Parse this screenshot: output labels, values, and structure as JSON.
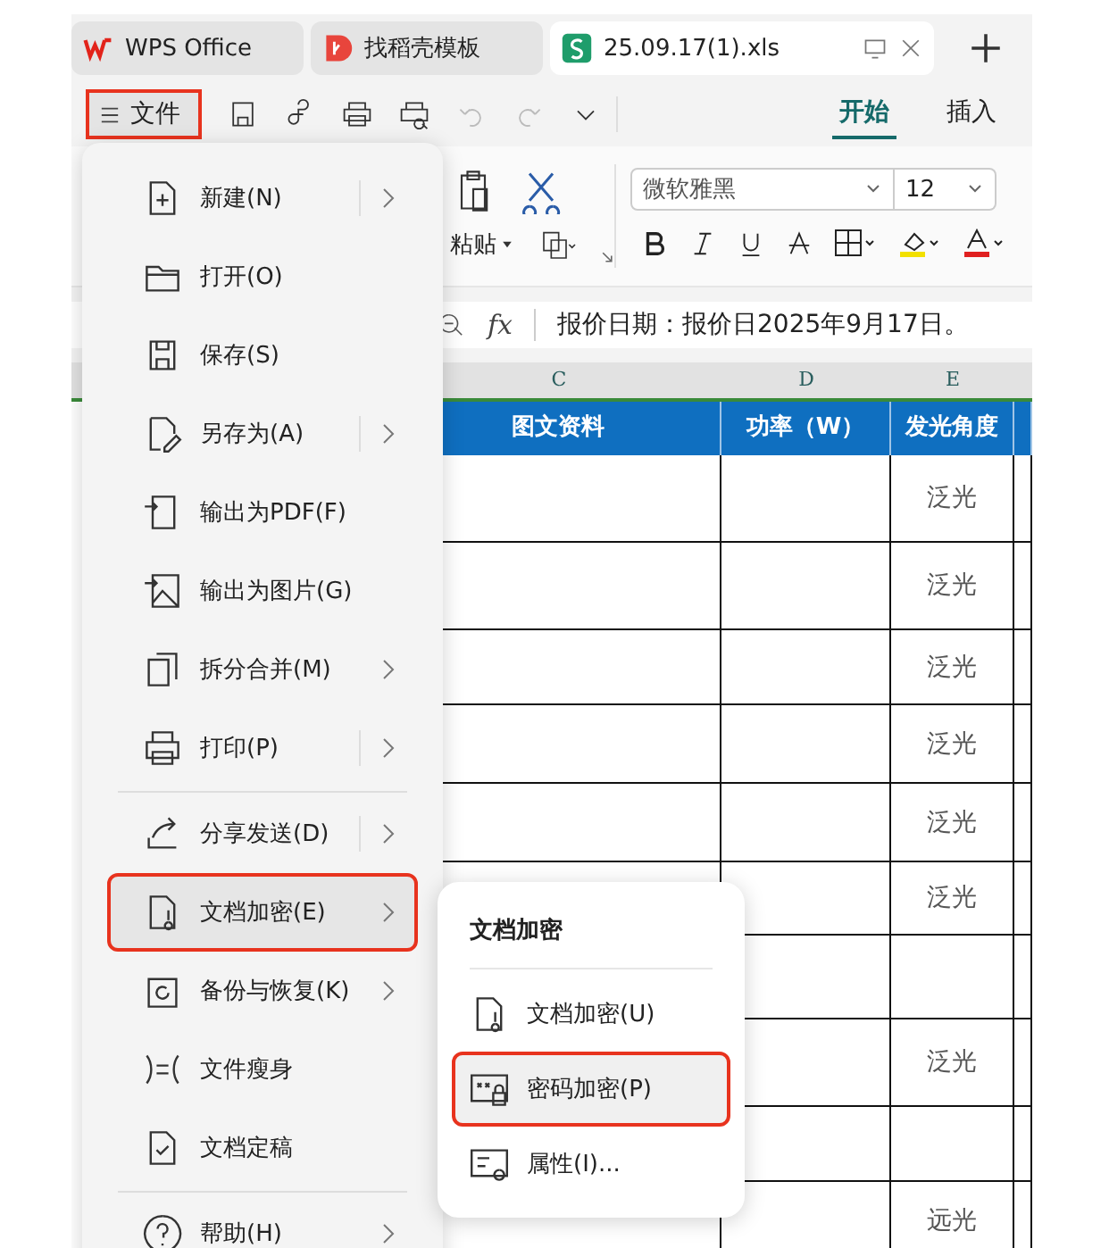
{
  "tabs": [
    {
      "label": "WPS Office",
      "kind": "wps",
      "selected": false
    },
    {
      "label": "找稻壳模板",
      "kind": "docer",
      "selected": false
    },
    {
      "label": "25.09.17(1).xls",
      "kind": "sheet",
      "selected": true
    }
  ],
  "toolbar": {
    "file_button": {
      "label": "文件",
      "annotated": true
    },
    "ribbon_tabs": [
      {
        "label": "开始",
        "selected": true
      },
      {
        "label": "插入",
        "selected": false
      }
    ]
  },
  "ribbon": {
    "paste_label": "粘贴",
    "font": "微软雅黑",
    "size": "12"
  },
  "formula_bar": {
    "fx": "fx",
    "value": "报价日期：报价日2025年9月17日。"
  },
  "sheet": {
    "column_letters": [
      "C",
      "D",
      "E"
    ],
    "header": [
      "图文资料",
      "功率（W）",
      "发光角度"
    ],
    "rows": [
      [
        "",
        "",
        "泛光"
      ],
      [
        "",
        "",
        "泛光"
      ],
      [
        "",
        "",
        "泛光"
      ],
      [
        "",
        "",
        "泛光"
      ],
      [
        "",
        "",
        "泛光"
      ],
      [
        "",
        "",
        "泛光"
      ],
      [
        "",
        "",
        ""
      ],
      [
        "",
        "",
        "泛光"
      ],
      [
        "",
        "",
        ""
      ],
      [
        "",
        "",
        "远光"
      ]
    ]
  },
  "file_menu": {
    "items": [
      {
        "kind": "item",
        "label": "新建(N)",
        "arrow": true,
        "split": true,
        "selected": false,
        "annotated": false
      },
      {
        "kind": "item",
        "label": "打开(O)",
        "arrow": false,
        "split": false,
        "selected": false,
        "annotated": false
      },
      {
        "kind": "item",
        "label": "保存(S)",
        "arrow": false,
        "split": false,
        "selected": false,
        "annotated": false
      },
      {
        "kind": "item",
        "label": "另存为(A)",
        "arrow": true,
        "split": true,
        "selected": false,
        "annotated": false
      },
      {
        "kind": "item",
        "label": "输出为PDF(F)",
        "arrow": false,
        "split": false,
        "selected": false,
        "annotated": false
      },
      {
        "kind": "item",
        "label": "输出为图片(G)",
        "arrow": false,
        "split": false,
        "selected": false,
        "annotated": false
      },
      {
        "kind": "item",
        "label": "拆分合并(M)",
        "arrow": true,
        "split": false,
        "selected": false,
        "annotated": false
      },
      {
        "kind": "item",
        "label": "打印(P)",
        "arrow": true,
        "split": true,
        "selected": false,
        "annotated": false
      },
      {
        "kind": "divider"
      },
      {
        "kind": "item",
        "label": "分享发送(D)",
        "arrow": true,
        "split": true,
        "selected": false,
        "annotated": false
      },
      {
        "kind": "item",
        "label": "文档加密(E)",
        "arrow": true,
        "split": false,
        "selected": true,
        "annotated": true
      },
      {
        "kind": "item",
        "label": "备份与恢复(K)",
        "arrow": true,
        "split": false,
        "selected": false,
        "annotated": false
      },
      {
        "kind": "item",
        "label": "文件瘦身",
        "arrow": false,
        "split": false,
        "selected": false,
        "annotated": false
      },
      {
        "kind": "item",
        "label": "文档定稿",
        "arrow": false,
        "split": false,
        "selected": false,
        "annotated": false
      },
      {
        "kind": "divider"
      },
      {
        "kind": "item",
        "label": "帮助(H)",
        "arrow": true,
        "split": false,
        "selected": false,
        "annotated": false
      }
    ]
  },
  "submenu": {
    "title": "文档加密",
    "items": [
      {
        "label": "文档加密(U)",
        "selected": false,
        "annotated": false
      },
      {
        "label": "密码加密(P)",
        "selected": true,
        "annotated": true
      },
      {
        "label": "属性(I)...",
        "selected": false,
        "annotated": false
      }
    ]
  }
}
